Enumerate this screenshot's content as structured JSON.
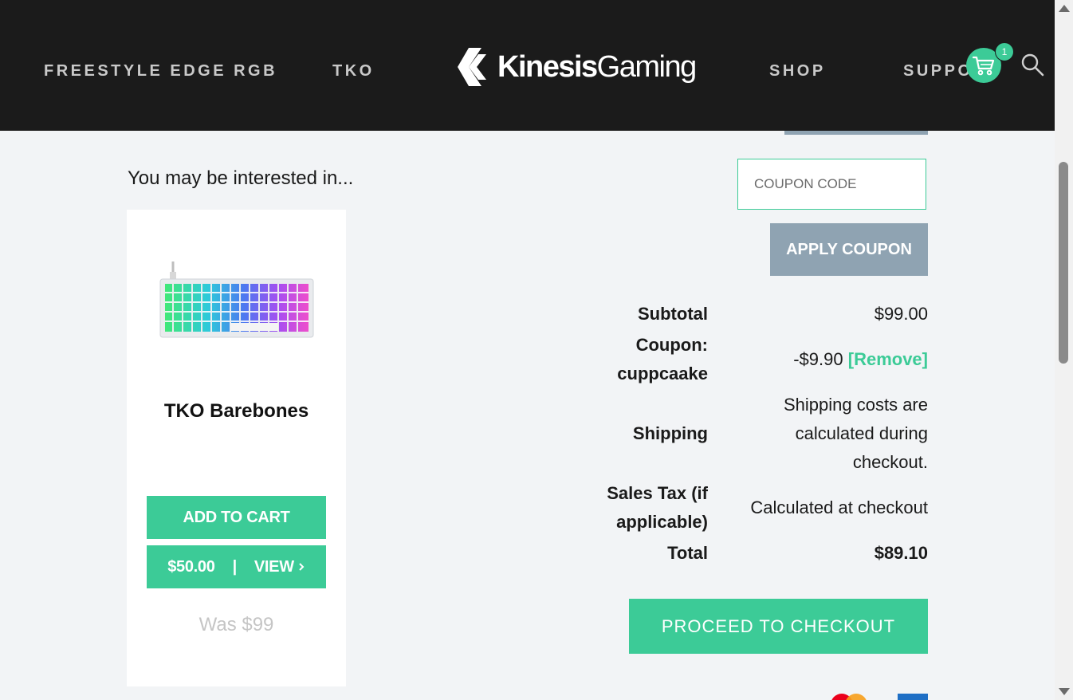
{
  "header": {
    "nav": {
      "freestyle": "FREESTYLE EDGE RGB",
      "tko": "TKO",
      "shop": "SHOP",
      "support": "SUPPO"
    },
    "logo": {
      "bold": "Kinesis",
      "light": "Gaming"
    },
    "cart_count": "1",
    "colors": {
      "background": "#1b1b1b",
      "accent": "#3ccb97"
    }
  },
  "recommendations": {
    "heading": "You may be interested in...",
    "product": {
      "title": "TKO Barebones",
      "add_to_cart": "ADD TO CART",
      "price": "$50.00",
      "separator": "|",
      "view": "VIEW",
      "was_price": "Was $99"
    }
  },
  "coupon": {
    "placeholder": "COUPON CODE",
    "apply_label": "APPLY COUPON"
  },
  "totals": {
    "subtotal_label": "Subtotal",
    "subtotal_value": "$99.00",
    "coupon_label_line1": "Coupon:",
    "coupon_label_line2": "cuppcaake",
    "coupon_value": "-$9.90",
    "coupon_remove": "[Remove]",
    "shipping_label": "Shipping",
    "shipping_line1": "Shipping costs are",
    "shipping_line2": "calculated during",
    "shipping_line3": "checkout.",
    "tax_label_line1": "Sales Tax (if",
    "tax_label_line2": "applicable)",
    "tax_value": "Calculated at checkout",
    "total_label": "Total",
    "total_value": "$89.10"
  },
  "checkout": {
    "label": "PROCEED TO CHECKOUT"
  }
}
